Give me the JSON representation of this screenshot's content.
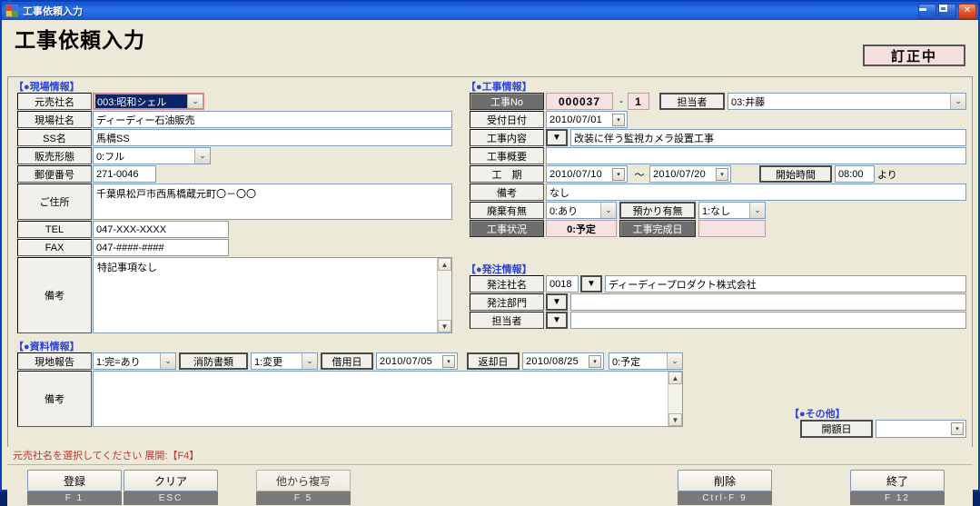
{
  "window": {
    "title": "工事依頼入力",
    "page_title": "工事依頼入力",
    "status_badge": "訂正中",
    "minimize": "_",
    "maximize": "□",
    "close": "✕"
  },
  "sections": {
    "site_info": "【●現場情報】",
    "work_info": "【●工事情報】",
    "order_info": "【●発注情報】",
    "doc_info": "【●資料情報】",
    "other_info": "【●その他】"
  },
  "site_info": {
    "motouri_label": "元売社名",
    "motouri_value": "003:昭和シェル",
    "genba_label": "現場社名",
    "genba_value": "ディーディー石油販売",
    "ss_label": "SS名",
    "ss_value": "馬橋SS",
    "hanbai_label": "販売形態",
    "hanbai_value": "0:フル",
    "yubin_label": "郵便番号",
    "yubin_value": "271-0046",
    "address_label": "ご住所",
    "address_value": "千葉県松戸市西馬橋蔵元町〇－〇〇",
    "tel_label": "TEL",
    "tel_value": "047-XXX-XXXX",
    "fax_label": "FAX",
    "fax_value": "047-####-####",
    "biko_label": "備考",
    "biko_value": "特記事項なし"
  },
  "work_info": {
    "kouji_no_label": "工事No",
    "kouji_no_main": "000037",
    "kouji_no_sep": "-",
    "kouji_no_sub": "1",
    "tantou_label": "担当者",
    "tantou_value": "03:井藤",
    "uketsuke_label": "受付日付",
    "uketsuke_value": "2010/07/01",
    "naiyou_label": "工事内容",
    "naiyou_value": "改装に伴う監視カメラ設置工事",
    "gaiyou_label": "工事概要",
    "gaiyou_value": "",
    "kouki_label": "工　期",
    "kouki_from": "2010/07/10",
    "kouki_tilde": "〜",
    "kouki_to": "2010/07/20",
    "start_time_label": "開始時間",
    "start_time_value": "08:00",
    "start_time_suffix": "より",
    "biko_label": "備考",
    "biko_value": "なし",
    "haiki_label": "廃棄有無",
    "haiki_value": "0:あり",
    "azukari_label": "預かり有無",
    "azukari_value": "1:なし",
    "jyoukyou_label": "工事状況",
    "jyoukyou_value": "0:予定",
    "kanseibi_label": "工事完成日",
    "kanseibi_value": ""
  },
  "order_info": {
    "company_label": "発注社名",
    "company_code": "0018",
    "company_value": "ディーディープロダクト株式会社",
    "dept_label": "発注部門",
    "dept_value": "",
    "tantou_label": "担当者",
    "tantou_value": ""
  },
  "doc_info": {
    "genchi_label": "現地報告",
    "genchi_value": "1:完=あり",
    "shoubou_label": "消防書類",
    "shoubou_value": "1:変更",
    "shakuyou_label": "借用日",
    "shakuyou_value": "2010/07/05",
    "henkyaku_label": "返却日",
    "henkyaku_value": "2010/08/25",
    "status_value": "0:予定",
    "biko_label": "備考",
    "biko_value": ""
  },
  "other_info": {
    "kaigaku_label": "開額日",
    "kaigaku_value": ""
  },
  "statusbar": {
    "message": "元売社名を選択してください  展開:【F4】"
  },
  "footer": {
    "buttons": [
      {
        "label": "登録",
        "key": "F 1"
      },
      {
        "label": "クリア",
        "key": "ESC"
      },
      {
        "label": "他から複写",
        "key": "F 5"
      },
      {
        "label": "削除",
        "key": "Ctrl-F 9"
      },
      {
        "label": "終了",
        "key": "F 12"
      }
    ]
  },
  "icons": {
    "dropdown_arrow": "▼",
    "combo_arrow": "❚",
    "scroll_up": "▲",
    "scroll_down": "▼"
  }
}
